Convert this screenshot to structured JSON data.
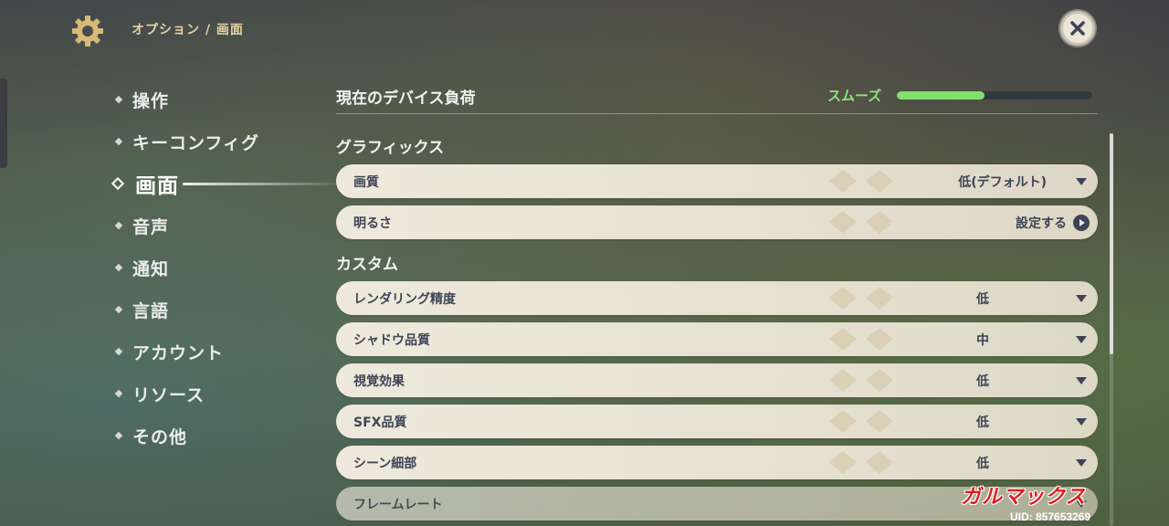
{
  "header": {
    "breadcrumb": "オプション / 画面",
    "gear_icon": "gear-icon",
    "close_icon": "close-icon"
  },
  "sidebar": {
    "items": [
      {
        "label": "操作",
        "active": false
      },
      {
        "label": "キーコンフィグ",
        "active": false
      },
      {
        "label": "画面",
        "active": true
      },
      {
        "label": "音声",
        "active": false
      },
      {
        "label": "通知",
        "active": false
      },
      {
        "label": "言語",
        "active": false
      },
      {
        "label": "アカウント",
        "active": false
      },
      {
        "label": "リソース",
        "active": false
      },
      {
        "label": "その他",
        "active": false
      }
    ]
  },
  "device_load": {
    "title": "現在のデバイス負荷",
    "status": "スムーズ",
    "level": 0.45,
    "status_color": "#83e06f"
  },
  "graphics": {
    "title": "グラフィックス",
    "rows": [
      {
        "label": "画質",
        "value": "低(デフォルト)",
        "control": "dropdown"
      },
      {
        "label": "明るさ",
        "value": "設定する",
        "control": "arrow"
      }
    ]
  },
  "custom": {
    "title": "カスタム",
    "rows": [
      {
        "label": "レンダリング精度",
        "value": "低",
        "control": "dropdown"
      },
      {
        "label": "シャドウ品質",
        "value": "中",
        "control": "dropdown"
      },
      {
        "label": "視覚効果",
        "value": "低",
        "control": "dropdown"
      },
      {
        "label": "SFX品質",
        "value": "低",
        "control": "dropdown"
      },
      {
        "label": "シーン細部",
        "value": "低",
        "control": "dropdown"
      },
      {
        "label": "フレームレート",
        "value": "",
        "control": "dropdown"
      }
    ]
  },
  "watermark": "ガルマックス",
  "uid": "UID: 857653269"
}
